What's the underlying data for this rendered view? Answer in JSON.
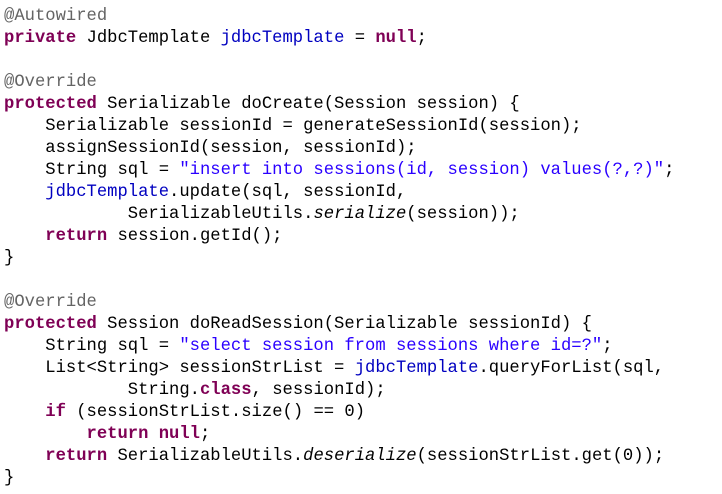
{
  "editor": {
    "language": "java",
    "colors": {
      "keyword": "#7f0055",
      "annotation": "#646464",
      "field": "#0000c0",
      "string": "#2a00ff",
      "default": "#000000"
    },
    "lines": [
      [
        {
          "t": "@Autowired",
          "k": "ann"
        }
      ],
      [
        {
          "t": "private",
          "k": "kw"
        },
        {
          "t": " JdbcTemplate "
        },
        {
          "t": "jdbcTemplate",
          "k": "field"
        },
        {
          "t": " = "
        },
        {
          "t": "null",
          "k": "kw"
        },
        {
          "t": ";"
        }
      ],
      [],
      [
        {
          "t": "@Override",
          "k": "ann"
        }
      ],
      [
        {
          "t": "protected",
          "k": "kw"
        },
        {
          "t": " Serializable doCreate(Session session) {"
        }
      ],
      [
        {
          "t": "    Serializable sessionId = generateSessionId(session);"
        }
      ],
      [
        {
          "t": "    assignSessionId(session, sessionId);"
        }
      ],
      [
        {
          "t": "    String sql = "
        },
        {
          "t": "\"insert into sessions(id, session) values(?,?)\"",
          "k": "str"
        },
        {
          "t": ";"
        }
      ],
      [
        {
          "t": "    "
        },
        {
          "t": "jdbcTemplate",
          "k": "field"
        },
        {
          "t": ".update(sql, sessionId,"
        }
      ],
      [
        {
          "t": "            SerializableUtils."
        },
        {
          "t": "serialize",
          "k": "static"
        },
        {
          "t": "(session));"
        }
      ],
      [
        {
          "t": "    "
        },
        {
          "t": "return",
          "k": "kw"
        },
        {
          "t": " session.getId();"
        }
      ],
      [
        {
          "t": "}"
        }
      ],
      [],
      [
        {
          "t": "@Override",
          "k": "ann"
        }
      ],
      [
        {
          "t": "protected",
          "k": "kw"
        },
        {
          "t": " Session doReadSession(Serializable sessionId) {"
        }
      ],
      [
        {
          "t": "    String sql = "
        },
        {
          "t": "\"select session from sessions where id=?\"",
          "k": "str"
        },
        {
          "t": ";"
        }
      ],
      [
        {
          "t": "    List<String> sessionStrList = "
        },
        {
          "t": "jdbcTemplate",
          "k": "field"
        },
        {
          "t": ".queryForList(sql,"
        }
      ],
      [
        {
          "t": "            String."
        },
        {
          "t": "class",
          "k": "kw"
        },
        {
          "t": ", sessionId);"
        }
      ],
      [
        {
          "t": "    "
        },
        {
          "t": "if",
          "k": "kw"
        },
        {
          "t": " (sessionStrList.size() == 0)"
        }
      ],
      [
        {
          "t": "        "
        },
        {
          "t": "return",
          "k": "kw"
        },
        {
          "t": " "
        },
        {
          "t": "null",
          "k": "kw"
        },
        {
          "t": ";"
        }
      ],
      [
        {
          "t": "    "
        },
        {
          "t": "return",
          "k": "kw"
        },
        {
          "t": " SerializableUtils."
        },
        {
          "t": "deserialize",
          "k": "static"
        },
        {
          "t": "(sessionStrList.get(0));"
        }
      ],
      [
        {
          "t": "}"
        }
      ]
    ]
  }
}
